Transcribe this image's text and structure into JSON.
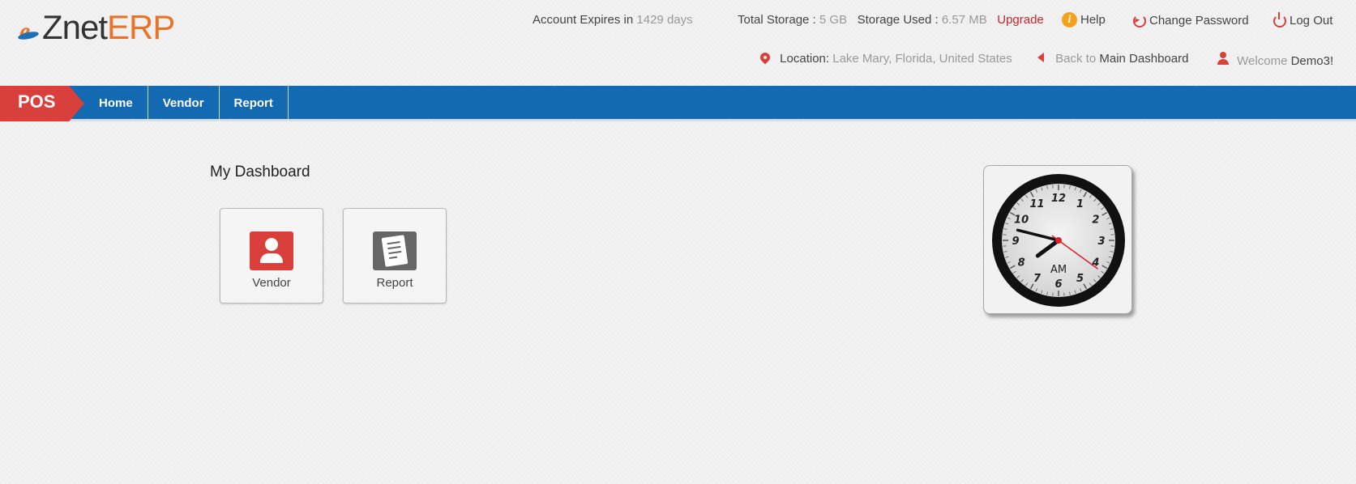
{
  "logo": {
    "prefix": "e",
    "name": "Znet",
    "suffix": "ERP"
  },
  "account": {
    "label": "Account Expires in",
    "value": "1429 days"
  },
  "storage": {
    "total_label": "Total Storage :",
    "total_value": "5 GB",
    "used_label": "Storage Used :",
    "used_value": "6.57 MB",
    "upgrade": "Upgrade"
  },
  "header_links": {
    "help": "Help",
    "change_password": "Change Password",
    "logout": "Log Out"
  },
  "location": {
    "label": "Location:",
    "value": "Lake Mary, Florida, United States"
  },
  "back": {
    "prefix": "Back to",
    "target": "Main Dashboard"
  },
  "welcome": {
    "prefix": "Welcome",
    "user": "Demo3!"
  },
  "nav": {
    "badge": "POS",
    "items": [
      {
        "label": "Home"
      },
      {
        "label": "Vendor"
      },
      {
        "label": "Report"
      }
    ]
  },
  "dashboard": {
    "title": "My Dashboard",
    "tiles": [
      {
        "label": "Vendor",
        "icon": "vendor-icon",
        "color": "#d9403b"
      },
      {
        "label": "Report",
        "icon": "report-icon",
        "color": "#666666"
      }
    ]
  },
  "clock": {
    "period": "AM",
    "hour": 7,
    "minute": 47,
    "second": 21,
    "numerals": [
      "12",
      "1",
      "2",
      "3",
      "4",
      "5",
      "6",
      "7",
      "8",
      "9",
      "10",
      "11"
    ]
  },
  "colors": {
    "accent": "#d9403b",
    "nav": "#1469b3",
    "logo_orange": "#e8732a"
  }
}
